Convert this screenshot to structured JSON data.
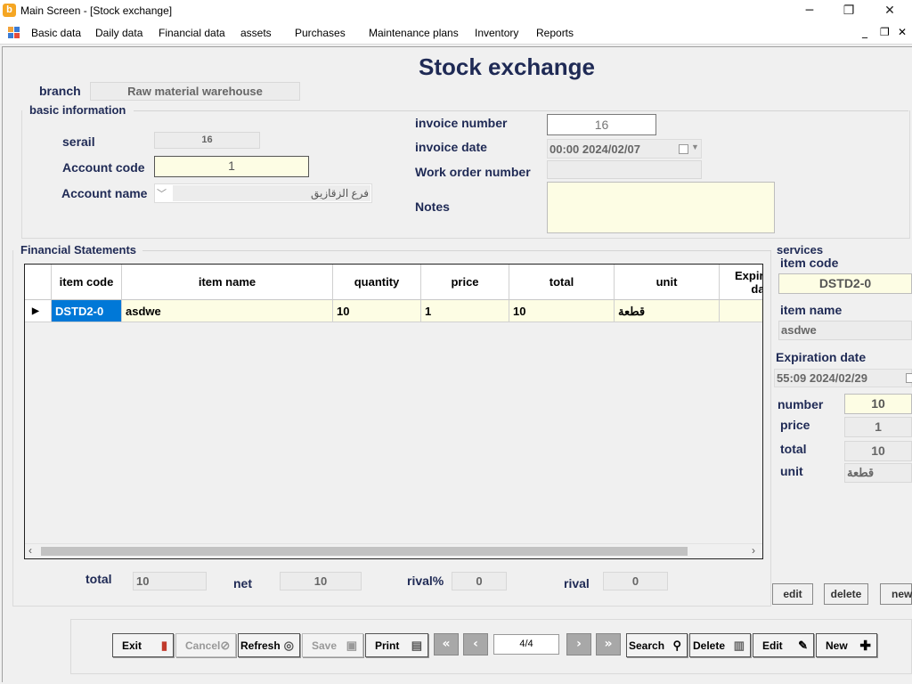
{
  "window": {
    "title": "Main Screen - [Stock exchange]",
    "minimize": "─",
    "maximize": "❐",
    "close": "✕"
  },
  "menu": {
    "items": [
      "Basic data",
      "Daily data",
      "Financial data",
      "assets",
      "Purchases",
      "Maintenance plans",
      "Inventory",
      "Reports"
    ],
    "mdi_min": "_",
    "mdi_restore": "❐",
    "mdi_close": "✕"
  },
  "form": {
    "title": "Stock exchange",
    "branch_label": "branch",
    "branch_value": "Raw material warehouse",
    "basic_info_label": "basic information",
    "serial_label": "serail",
    "serial_value": "16",
    "account_code_label": "Account code",
    "account_code_value": "1",
    "account_name_label": "Account name",
    "account_name_value": "فرع الزقازيق",
    "invoice_number_label": "invoice number",
    "invoice_number_value": "16",
    "invoice_date_label": "invoice date",
    "invoice_date_value": "00:00 2024/02/07",
    "work_order_label": "Work order number",
    "work_order_value": "",
    "notes_label": "Notes",
    "notes_value": ""
  },
  "financial": {
    "label": "Financial Statements",
    "columns": [
      "item code",
      "item name",
      "quantity",
      "price",
      "total",
      "unit",
      "Expiration date"
    ],
    "rows": [
      [
        "DSTD2-0",
        "asdwe",
        "10",
        "1",
        "10",
        "قطعة",
        ""
      ]
    ]
  },
  "services": {
    "label": "services",
    "item_code_label": "item code",
    "item_code_value": "DSTD2-0",
    "item_name_label": "item name",
    "item_name_value": "asdwe",
    "expiration_label": "Expiration date",
    "expiration_value": "55:09 2024/02/29",
    "number_label": "number",
    "number_value": "10",
    "price_label": "price",
    "price_value": "1",
    "total_label": "total",
    "total_value": "10",
    "unit_label": "unit",
    "unit_value": "قطعة",
    "edit_label": "edit",
    "delete_label": "delete",
    "new_label": "new"
  },
  "totals": {
    "total_label": "total",
    "total_value": "10",
    "net_label": "net",
    "net_value": "10",
    "rival_pct_label": "rival%",
    "rival_pct_value": "0",
    "rival_label": "rival",
    "rival_value": "0"
  },
  "toolbar": {
    "exit": "Exit",
    "cancel": "Cancel",
    "refresh": "Refresh",
    "save": "Save",
    "print": "Print",
    "record_position": "4/4",
    "search": "Search",
    "delete": "Delete",
    "edit": "Edit",
    "new": "New"
  },
  "colors": {
    "selection": "#0078d7",
    "title_text": "#1f2a55",
    "editable_field": "#fdfde4"
  }
}
